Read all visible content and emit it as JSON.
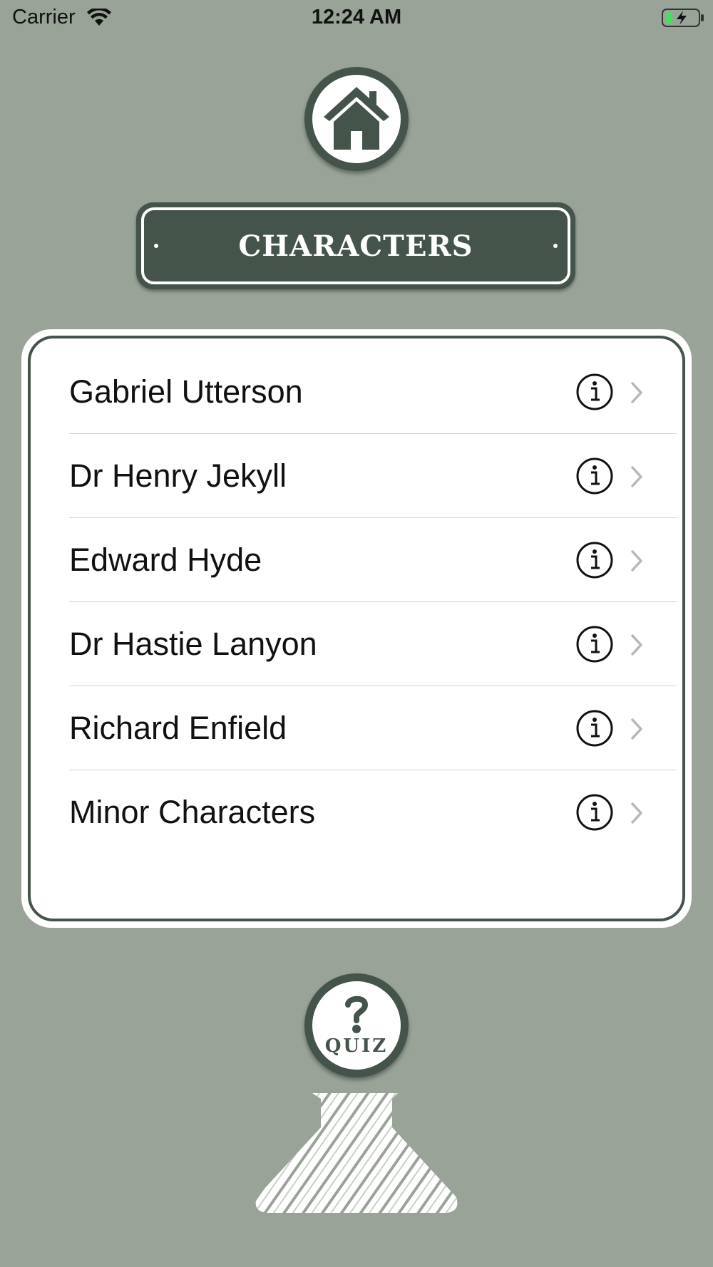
{
  "status_bar": {
    "carrier": "Carrier",
    "time": "12:24 AM",
    "wifi_icon": "wifi-icon",
    "battery_icon": "battery-charging-icon"
  },
  "home_button": {
    "icon": "home-icon"
  },
  "title": "CHARACTERS",
  "characters": [
    {
      "label": "Gabriel Utterson"
    },
    {
      "label": "Dr Henry Jekyll"
    },
    {
      "label": "Edward Hyde"
    },
    {
      "label": "Dr Hastie Lanyon"
    },
    {
      "label": "Richard Enfield"
    },
    {
      "label": "Minor Characters"
    }
  ],
  "quiz_button": {
    "label": "QUIZ",
    "icon": "question-mark-icon"
  },
  "colors": {
    "background": "#99a398",
    "accent": "#44544a",
    "card": "#ffffff",
    "battery_fill": "#4cd964"
  }
}
